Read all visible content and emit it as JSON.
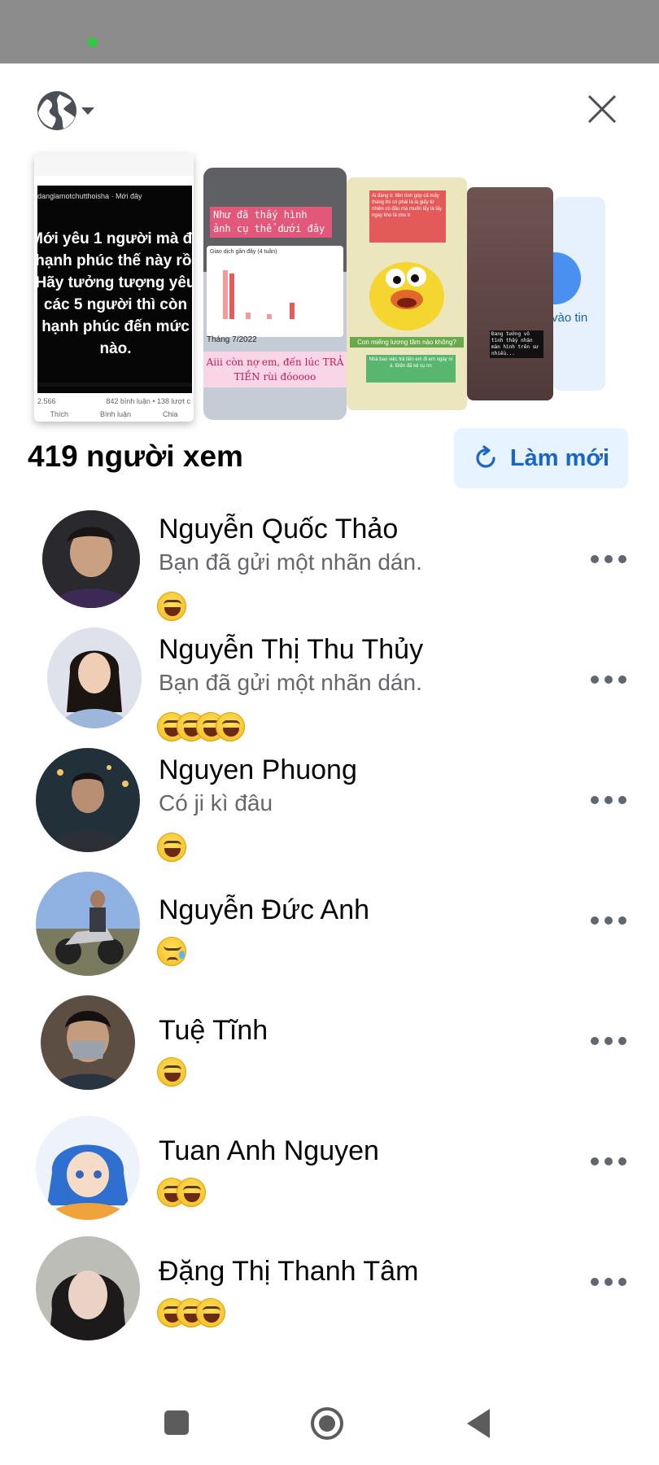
{
  "colors": {
    "accent": "#1866c7",
    "refresh_bg": "#e7f3ff",
    "secondary_text": "#65676b",
    "status_bar": "#8c8c8c"
  },
  "header": {
    "privacy_icon": "globe-icon",
    "privacy_menu_icon": "caret-down-icon",
    "close_icon": "close-icon"
  },
  "stories": [
    {
      "user": "danglamotchutthoisha · Mới đây",
      "text": "Mới yêu 1 người mà đã hạnh phúc thế này rồi Hãy tưởng tượng yêu các 5 người thì còn hạnh phúc đến mức nào.",
      "reactions_count": "2.566",
      "comments": "842 bình luận • 138 lượt c",
      "action_like": "Thích",
      "action_comment": "Bình luận",
      "action_share": "Chia"
    },
    {
      "caption": "Như đã thấy hình ảnh cụ thể dưới đây",
      "card_title": "Giao dịch gần đây (4 tuần)",
      "month": "Tháng 7/2022",
      "bottom_text": "Aiii còn nợ em, đến lúc TRẢ TIỀN rùi đóoooo"
    },
    {
      "top_text": "Ai đang tr. tiền tình góp cả mấy tháng thì có phải là là giấy từ nhiên có đâu mà muốn lấy là lấy ngay kho là cho tr",
      "question": "Con miếng lương tâm nào không?",
      "bottom_text": "Nhà bao việc trả tiền em đi em ngày ní á. Điện đã kệ cụ nn"
    },
    {
      "text": "Đang tưởng vô tình thấy nhận màn hình trên sư nhiều..."
    },
    {
      "text": "vào tin"
    }
  ],
  "viewers_header": {
    "count_label": "419 người xem",
    "refresh_label": "Làm mới",
    "refresh_icon": "refresh-icon"
  },
  "viewers": [
    {
      "name": "Nguyễn Quốc Thảo",
      "reply": "Bạn đã gửi một nhãn dán.",
      "reactions": [
        "laughing"
      ],
      "avatar_bg": "#3a2d3c"
    },
    {
      "name": "Nguyễn Thị Thu Thủy",
      "reply": "Bạn đã gửi một nhãn dán.",
      "reactions": [
        "laughing",
        "laughing",
        "laughing",
        "laughing"
      ],
      "avatar_bg": "#d9dde6"
    },
    {
      "name": "Nguyen Phuong",
      "reply": "Có ji kì đâu",
      "reactions": [
        "laughing"
      ],
      "avatar_bg": "#2f3b45"
    },
    {
      "name": "Nguyễn Đức Anh",
      "reply": "",
      "reactions": [
        "sad"
      ],
      "avatar_bg": "#6b86b5"
    },
    {
      "name": "Tuệ Tĩnh",
      "reply": "",
      "reactions": [
        "laughing"
      ],
      "avatar_bg": "#4a4038"
    },
    {
      "name": "Tuan Anh Nguyen",
      "reply": "",
      "reactions": [
        "laughing",
        "laughing"
      ],
      "avatar_bg": "#3d7fc6"
    },
    {
      "name": "Đặng Thị Thanh Tâm",
      "reply": "",
      "reactions": [
        "laughing",
        "laughing",
        "laughing"
      ],
      "avatar_bg": "#8a8a88"
    }
  ],
  "navigation": {
    "recent_icon": "square-icon",
    "home_icon": "circle-icon",
    "back_icon": "back-triangle-icon"
  }
}
